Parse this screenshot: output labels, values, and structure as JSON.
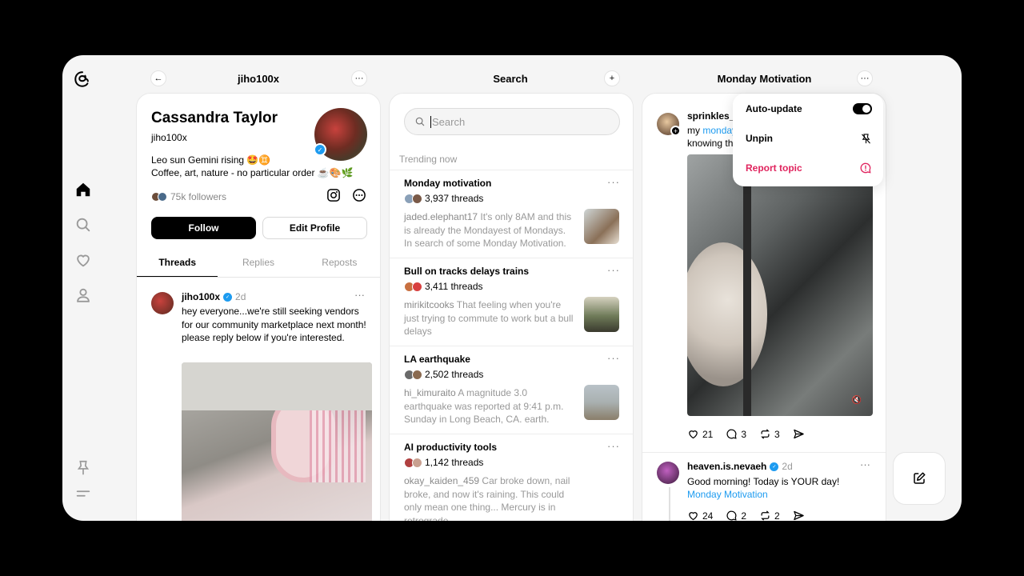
{
  "profile_column": {
    "header_title": "jiho100x",
    "name": "Cassandra Taylor",
    "handle": "jiho100x",
    "bio_line1": "Leo sun Gemini rising 🤩♊",
    "bio_line2": "Coffee, art, nature - no particular order ☕🎨🌿",
    "followers": "75k followers",
    "follow_label": "Follow",
    "edit_label": "Edit Profile",
    "tabs": [
      "Threads",
      "Replies",
      "Reposts"
    ],
    "post": {
      "username": "jiho100x",
      "time": "2d",
      "text": "hey everyone...we're still seeking vendors for our community marketplace next month! please reply below if you're interested."
    }
  },
  "search_column": {
    "header_title": "Search",
    "placeholder": "Search",
    "trending_label": "Trending now",
    "trends": [
      {
        "name": "Monday motivation",
        "count": "3,937 threads",
        "user": "jaded.elephant17",
        "snippet": " It's only 8AM and this is already the Mondayest of Mondays. In search of some Monday Motivation."
      },
      {
        "name": "Bull on tracks delays trains",
        "count": "3,411 threads",
        "user": "mirikitcooks",
        "snippet": " That feeling when you're just trying to commute to work but a bull delays"
      },
      {
        "name": "LA earthquake",
        "count": "2,502 threads",
        "user": "hi_kimuraito",
        "snippet": " A magnitude 3.0 earthquake was reported at 9:41 p.m. Sunday in Long Beach, CA. earth."
      },
      {
        "name": "AI productivity tools",
        "count": "1,142 threads",
        "user": "okay_kaiden_459",
        "snippet": " Car broke down, nail broke, and now it's raining. This could only mean one thing... Mercury is in retrograde."
      }
    ]
  },
  "feed_column": {
    "header_title": "Monday Motivation",
    "post1": {
      "username": "sprinkles_b",
      "text_prefix": "my ",
      "text_link": "monday",
      "text_line2": "knowing th",
      "likes": "21",
      "replies": "3",
      "reposts": "3"
    },
    "post2": {
      "username": "heaven.is.nevaeh",
      "time": "2d",
      "text": "Good morning! Today is YOUR day!",
      "tag": "Monday Motivation",
      "likes": "24",
      "replies": "2",
      "reposts": "2"
    }
  },
  "menu": {
    "auto_update": "Auto-update",
    "unpin": "Unpin",
    "report": "Report topic",
    "report_color": "#e0245e"
  }
}
